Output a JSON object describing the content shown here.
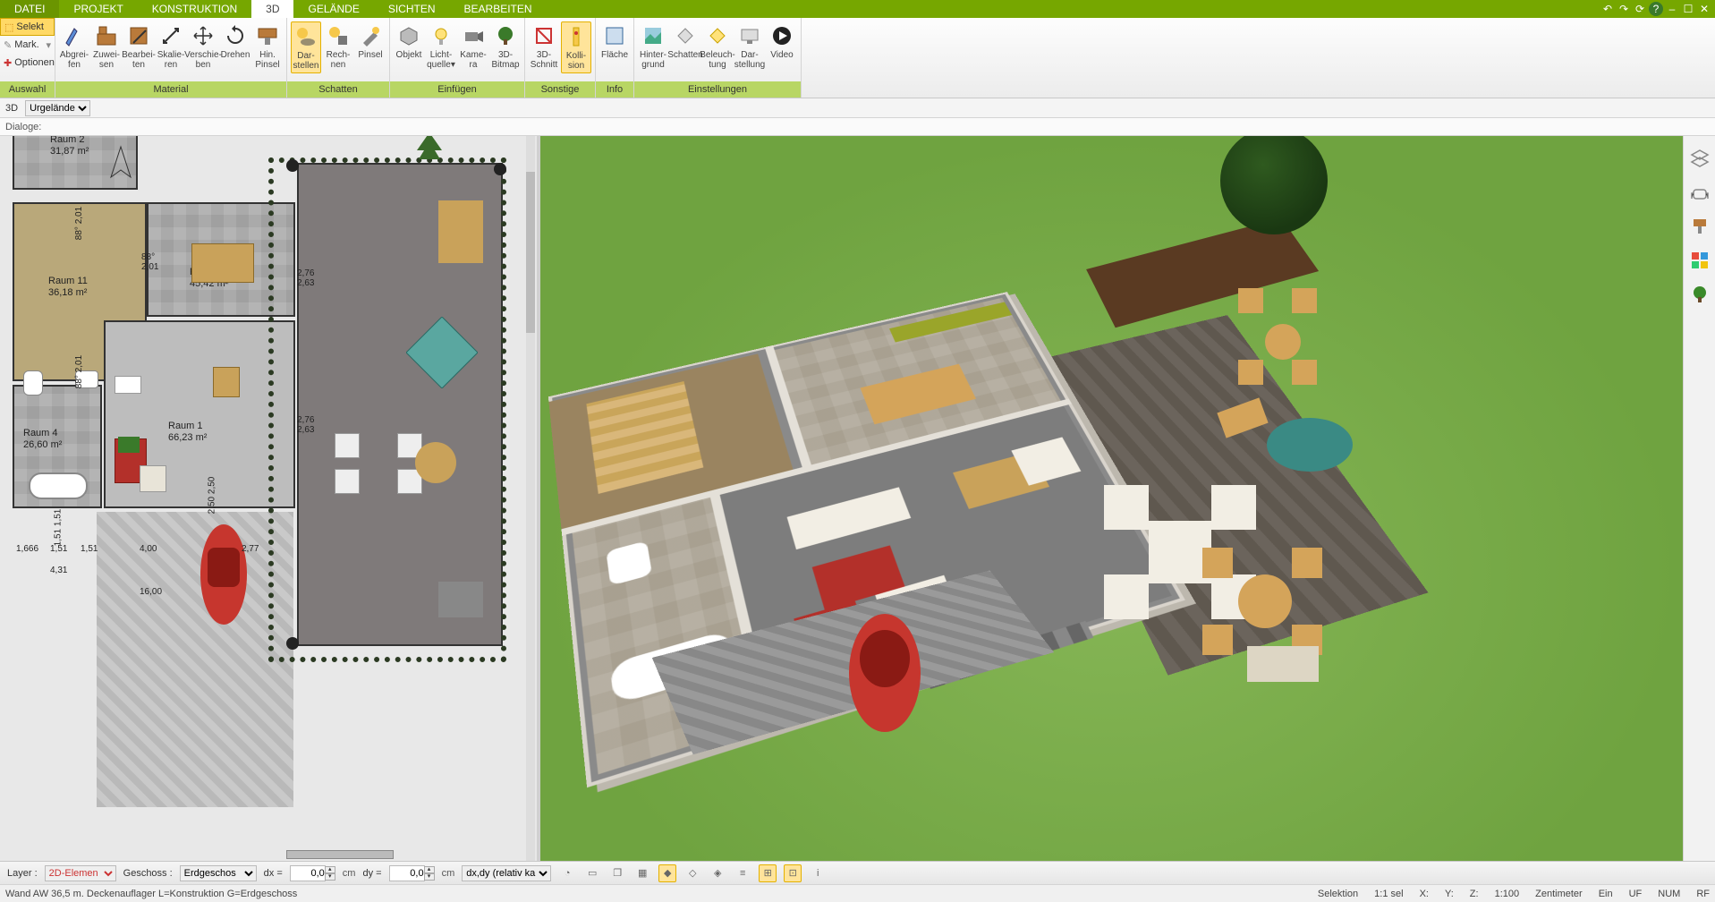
{
  "menu": {
    "tabs": [
      "DATEI",
      "PROJEKT",
      "KONSTRUKTION",
      "3D",
      "GELÄNDE",
      "SICHTEN",
      "BEARBEITEN"
    ],
    "active_index": 3
  },
  "left_buttons": {
    "selekt": "Selekt",
    "mark": "Mark.",
    "optionen": "Optionen",
    "group_label": "Auswahl"
  },
  "ribbon_groups": [
    {
      "label": "Material",
      "buttons": [
        {
          "id": "abgreifen",
          "l1": "Abgrei-",
          "l2": "fen"
        },
        {
          "id": "zuweisen",
          "l1": "Zuwei-",
          "l2": "sen"
        },
        {
          "id": "bearbeiten",
          "l1": "Bearbei-",
          "l2": "ten"
        },
        {
          "id": "skalieren",
          "l1": "Skalie-",
          "l2": "ren"
        },
        {
          "id": "verschieben",
          "l1": "Verschie-",
          "l2": "ben"
        },
        {
          "id": "drehen",
          "l1": "Drehen",
          "l2": ""
        },
        {
          "id": "hinpinsel",
          "l1": "Hin.",
          "l2": "Pinsel"
        }
      ]
    },
    {
      "label": "Schatten",
      "buttons": [
        {
          "id": "darstellen",
          "l1": "Dar-",
          "l2": "stellen",
          "active": true
        },
        {
          "id": "rechnen",
          "l1": "Rech-",
          "l2": "nen"
        },
        {
          "id": "pinsel",
          "l1": "Pinsel",
          "l2": ""
        }
      ]
    },
    {
      "label": "Einfügen",
      "buttons": [
        {
          "id": "objekt",
          "l1": "Objekt",
          "l2": ""
        },
        {
          "id": "lichtquelle",
          "l1": "Licht-",
          "l2": "quelle"
        },
        {
          "id": "kamera",
          "l1": "Kame-",
          "l2": "ra"
        },
        {
          "id": "3dbitmap",
          "l1": "3D-",
          "l2": "Bitmap"
        }
      ]
    },
    {
      "label": "Sonstige",
      "buttons": [
        {
          "id": "3dschnitt",
          "l1": "3D-",
          "l2": "Schnitt"
        },
        {
          "id": "kollision",
          "l1": "Kolli-",
          "l2": "sion",
          "active": true
        }
      ]
    },
    {
      "label": "Info",
      "buttons": [
        {
          "id": "flaeche",
          "l1": "Fläche",
          "l2": ""
        }
      ]
    },
    {
      "label": "Einstellungen",
      "buttons": [
        {
          "id": "hintergrund",
          "l1": "Hinter-",
          "l2": "grund"
        },
        {
          "id": "schatten",
          "l1": "Schatten",
          "l2": ""
        },
        {
          "id": "beleuchtung",
          "l1": "Beleuch-",
          "l2": "tung"
        },
        {
          "id": "darstellung",
          "l1": "Dar-",
          "l2": "stellung"
        },
        {
          "id": "video",
          "l1": "Video",
          "l2": ""
        }
      ]
    }
  ],
  "subbar": {
    "view_mode": "3D",
    "terrain_label": "Urgelände"
  },
  "dialog_label": "Dialoge:",
  "rooms": {
    "r2": {
      "name": "Raum 2",
      "area": "31,87 m²"
    },
    "r11": {
      "name": "Raum 11",
      "area": "36,18 m²"
    },
    "r3": {
      "name": "Raum 3",
      "area": "45,42 m²"
    },
    "r1": {
      "name": "Raum 1",
      "area": "66,23 m²"
    },
    "r4": {
      "name": "Raum 4",
      "area": "26,60 m²"
    }
  },
  "dims": {
    "d1": "88°",
    "d2": "2,01",
    "d3": "88°",
    "d4": "2,01",
    "d5": "88°",
    "d6": "2,01",
    "d7": "2,76",
    "d8": "2,63",
    "d9": "2,76",
    "d10": "2,63",
    "d11": "2,50",
    "d12": "2,50",
    "d13": "1,51",
    "d14": "1,51",
    "d15": "1,666",
    "d16": "1,51",
    "d17": "1,51",
    "d18": "4,00",
    "d19": "2,77",
    "d20": "4,31",
    "d21": "16,00"
  },
  "bottom": {
    "layer_label": "Layer :",
    "layer_value": "2D-Elemen",
    "geschoss_label": "Geschoss :",
    "geschoss_value": "Erdgeschos",
    "dx_label": "dx =",
    "dx_value": "0,0",
    "dy_label": "dy =",
    "dy_value": "0,0",
    "unit": "cm",
    "coord_mode": "dx,dy (relativ ka"
  },
  "status": {
    "left": "Wand AW 36,5 m. Deckenauflager L=Konstruktion G=Erdgeschoss",
    "selektion": "Selektion",
    "sel": "1:1 sel",
    "x": "X:",
    "y": "Y:",
    "z": "Z:",
    "scale": "1:100",
    "unit": "Zentimeter",
    "ein": "Ein",
    "uf": "UF",
    "num": "NUM",
    "rf": "RF"
  }
}
